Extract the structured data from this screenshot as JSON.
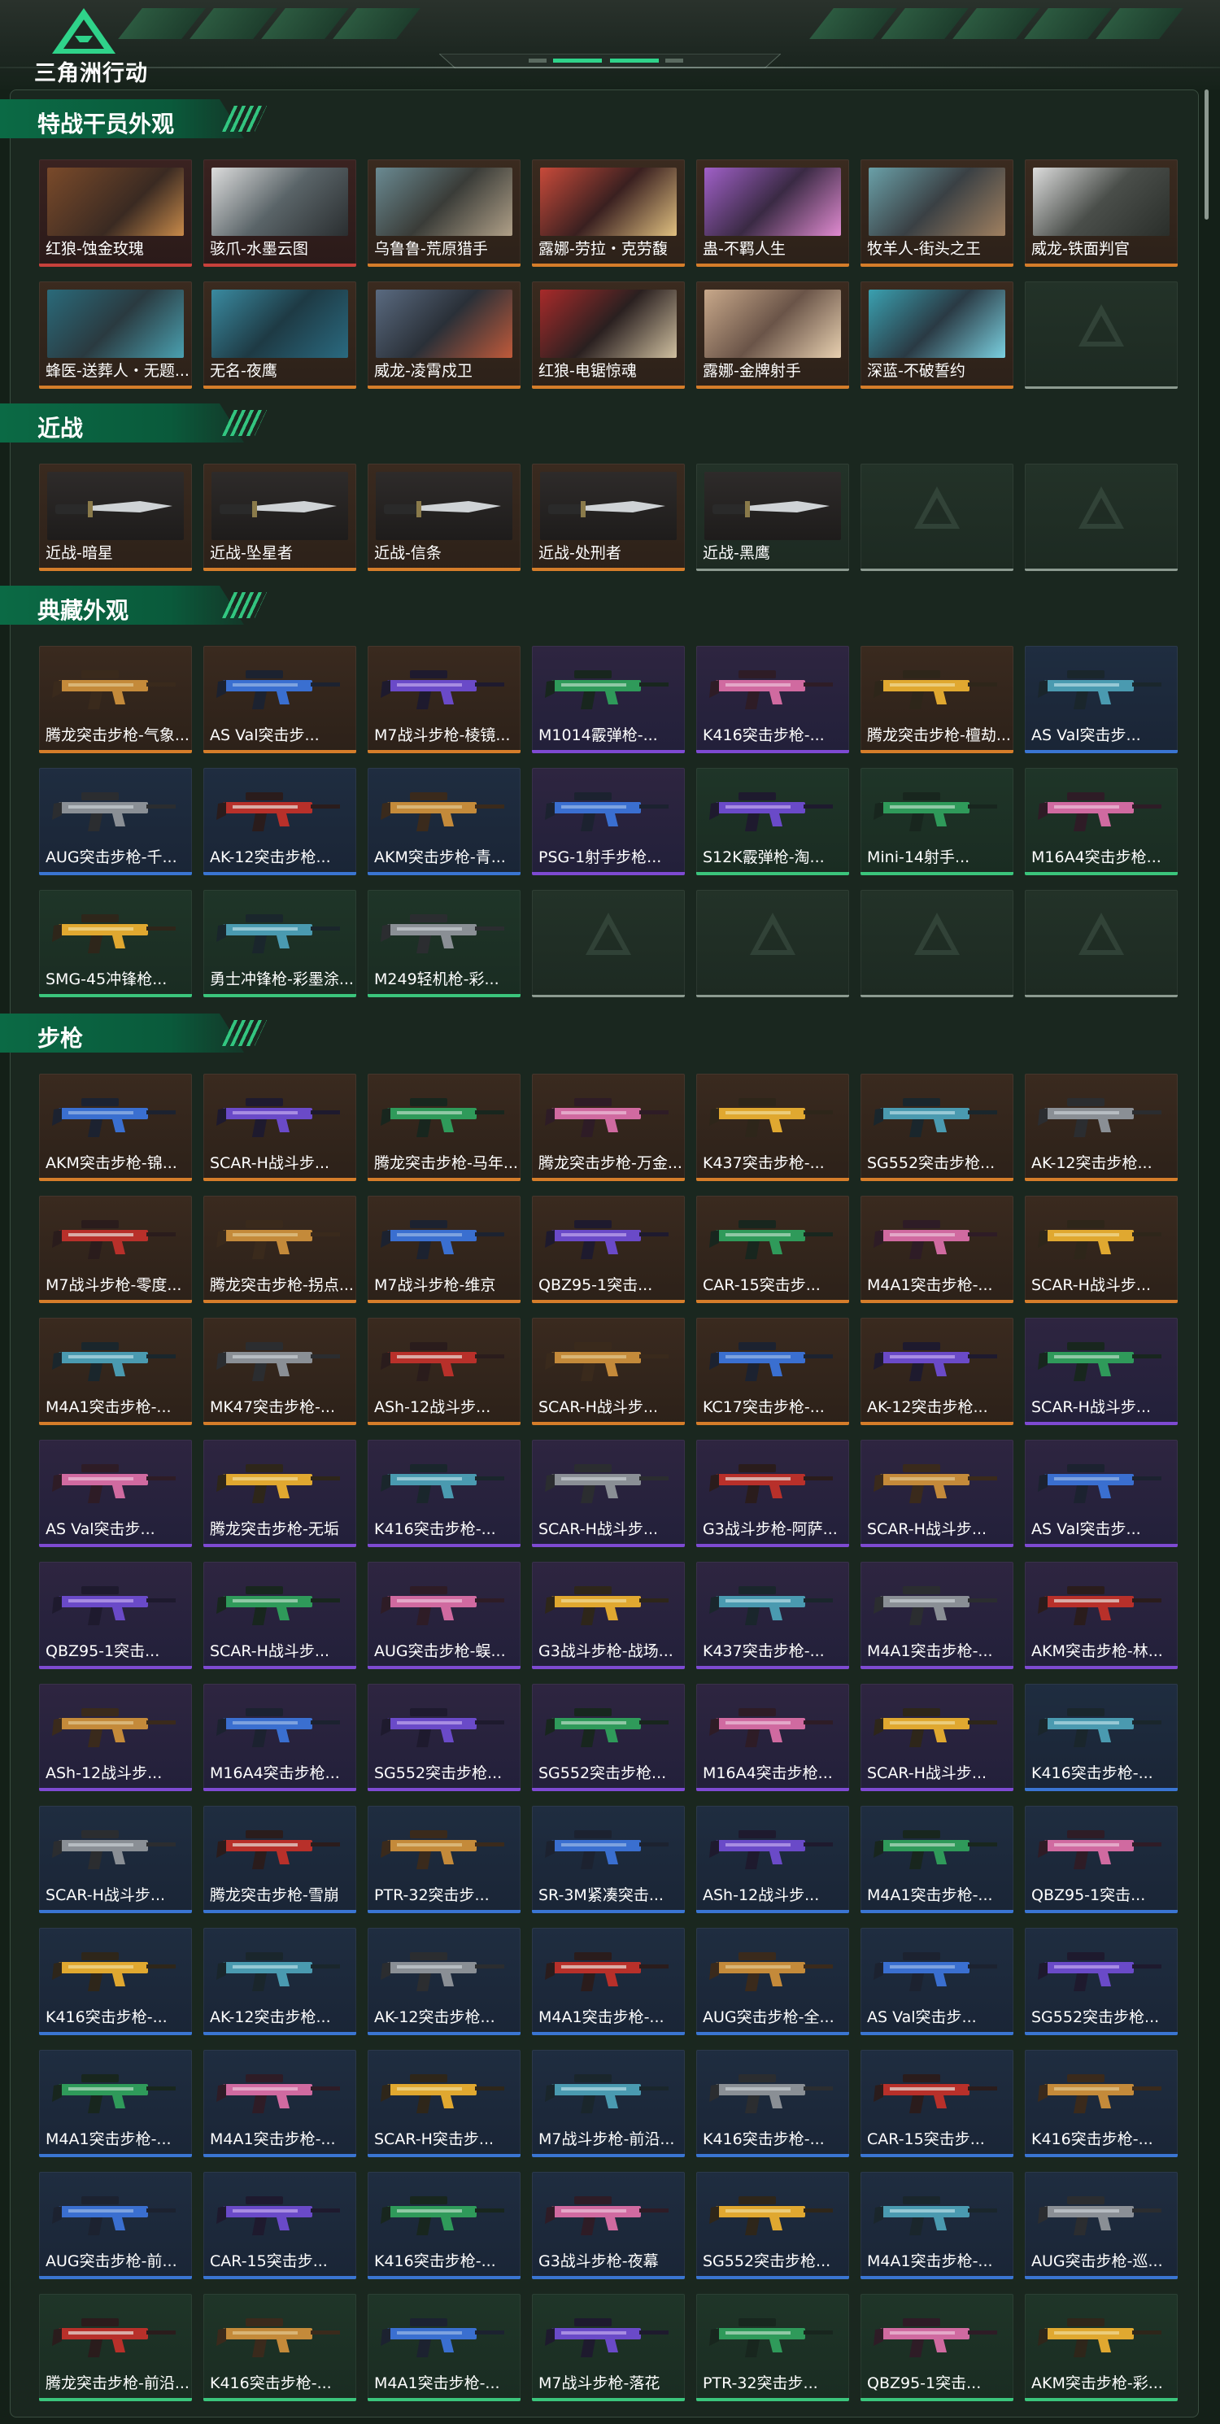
{
  "header": {
    "logo_text": "三角洲行动"
  },
  "colors": {
    "accent": "#0b6a45",
    "accent_light": "#36d68a",
    "rarity_gold": "#d57d2a",
    "rarity_red": "#c8413b",
    "rarity_purple": "#7e4ad2",
    "rarity_blue": "#3a75d2",
    "rarity_green": "#3bc57c"
  },
  "sections": [
    {
      "title": "特战干员外观",
      "items": [
        {
          "label": "红狼-蚀金玫瑰",
          "rarity": "red",
          "icon": "operator-portrait"
        },
        {
          "label": "骇爪-水墨云图",
          "rarity": "red",
          "icon": "operator-portrait"
        },
        {
          "label": "乌鲁鲁-荒原猎手",
          "rarity": "gold",
          "icon": "operator-portrait"
        },
        {
          "label": "露娜-劳拉・克劳馥",
          "rarity": "gold",
          "icon": "operator-portrait"
        },
        {
          "label": "蛊-不羁人生",
          "rarity": "gold",
          "icon": "operator-portrait"
        },
        {
          "label": "牧羊人-街头之王",
          "rarity": "gold",
          "icon": "operator-portrait"
        },
        {
          "label": "威龙-铁面判官",
          "rarity": "gold",
          "icon": "operator-portrait"
        },
        {
          "label": "蜂医-送葬人・无题...",
          "rarity": "gold",
          "icon": "operator-portrait"
        },
        {
          "label": "无名-夜鹰",
          "rarity": "gold",
          "icon": "operator-portrait"
        },
        {
          "label": "威龙-凌霄戍卫",
          "rarity": "gold",
          "icon": "operator-portrait"
        },
        {
          "label": "红狼-电锯惊魂",
          "rarity": "gold",
          "icon": "operator-portrait"
        },
        {
          "label": "露娜-金牌射手",
          "rarity": "gold",
          "icon": "operator-portrait"
        },
        {
          "label": "深蓝-不破誓约",
          "rarity": "gold",
          "icon": "operator-portrait"
        },
        {
          "label": "",
          "rarity": "empty",
          "icon": "empty-slot"
        }
      ]
    },
    {
      "title": "近战",
      "items": [
        {
          "label": "近战-暗星",
          "rarity": "gold",
          "icon": "knife"
        },
        {
          "label": "近战-坠星者",
          "rarity": "gold",
          "icon": "knife"
        },
        {
          "label": "近战-信条",
          "rarity": "gold",
          "icon": "knife"
        },
        {
          "label": "近战-处刑者",
          "rarity": "gold",
          "icon": "knife"
        },
        {
          "label": "近战-黑鹰",
          "rarity": "empty",
          "icon": "knife"
        },
        {
          "label": "",
          "rarity": "empty",
          "icon": "empty-slot"
        },
        {
          "label": "",
          "rarity": "empty",
          "icon": "empty-slot"
        }
      ]
    },
    {
      "title": "典藏外观",
      "items": [
        {
          "label": "腾龙突击步枪-气象...",
          "rarity": "gold",
          "icon": "rifle"
        },
        {
          "label": "AS Val突击步...",
          "rarity": "gold",
          "icon": "rifle"
        },
        {
          "label": "M7战斗步枪-棱镜...",
          "rarity": "gold",
          "icon": "rifle"
        },
        {
          "label": "M1014霰弹枪-...",
          "rarity": "purple",
          "icon": "rifle"
        },
        {
          "label": "K416突击步枪-...",
          "rarity": "purple",
          "icon": "rifle"
        },
        {
          "label": "腾龙突击步枪-檀劫...",
          "rarity": "gold",
          "icon": "rifle"
        },
        {
          "label": "AS Val突击步...",
          "rarity": "blue",
          "icon": "rifle"
        },
        {
          "label": "AUG突击步枪-千...",
          "rarity": "blue",
          "icon": "rifle"
        },
        {
          "label": "AK-12突击步枪...",
          "rarity": "blue",
          "icon": "rifle"
        },
        {
          "label": "AKM突击步枪-青...",
          "rarity": "blue",
          "icon": "rifle"
        },
        {
          "label": "PSG-1射手步枪...",
          "rarity": "purple",
          "icon": "rifle"
        },
        {
          "label": "S12K霰弹枪-淘...",
          "rarity": "green",
          "icon": "rifle"
        },
        {
          "label": "Mini-14射手...",
          "rarity": "green",
          "icon": "rifle"
        },
        {
          "label": "M16A4突击步枪...",
          "rarity": "green",
          "icon": "rifle"
        },
        {
          "label": "SMG-45冲锋枪...",
          "rarity": "green",
          "icon": "rifle"
        },
        {
          "label": "勇士冲锋枪-彩墨涂...",
          "rarity": "green",
          "icon": "rifle"
        },
        {
          "label": "M249轻机枪-彩...",
          "rarity": "green",
          "icon": "rifle"
        },
        {
          "label": "",
          "rarity": "empty",
          "icon": "empty-slot"
        },
        {
          "label": "",
          "rarity": "empty",
          "icon": "empty-slot"
        },
        {
          "label": "",
          "rarity": "empty",
          "icon": "empty-slot"
        },
        {
          "label": "",
          "rarity": "empty",
          "icon": "empty-slot"
        }
      ]
    },
    {
      "title": "步枪",
      "items": [
        {
          "label": "AKM突击步枪-锦...",
          "rarity": "gold",
          "icon": "rifle"
        },
        {
          "label": "SCAR-H战斗步...",
          "rarity": "gold",
          "icon": "rifle"
        },
        {
          "label": "腾龙突击步枪-马年...",
          "rarity": "gold",
          "icon": "rifle"
        },
        {
          "label": "腾龙突击步枪-万金...",
          "rarity": "gold",
          "icon": "rifle"
        },
        {
          "label": "K437突击步枪-...",
          "rarity": "gold",
          "icon": "rifle"
        },
        {
          "label": "SG552突击步枪...",
          "rarity": "gold",
          "icon": "rifle"
        },
        {
          "label": "AK-12突击步枪...",
          "rarity": "gold",
          "icon": "rifle"
        },
        {
          "label": "M7战斗步枪-零度...",
          "rarity": "gold",
          "icon": "rifle"
        },
        {
          "label": "腾龙突击步枪-拐点...",
          "rarity": "gold",
          "icon": "rifle"
        },
        {
          "label": "M7战斗步枪-维京",
          "rarity": "gold",
          "icon": "rifle"
        },
        {
          "label": "QBZ95-1突击...",
          "rarity": "gold",
          "icon": "rifle"
        },
        {
          "label": "CAR-15突击步...",
          "rarity": "gold",
          "icon": "rifle"
        },
        {
          "label": "M4A1突击步枪-...",
          "rarity": "gold",
          "icon": "rifle"
        },
        {
          "label": "SCAR-H战斗步...",
          "rarity": "gold",
          "icon": "rifle"
        },
        {
          "label": "M4A1突击步枪-...",
          "rarity": "gold",
          "icon": "rifle"
        },
        {
          "label": "MK47突击步枪-...",
          "rarity": "gold",
          "icon": "rifle"
        },
        {
          "label": "ASh-12战斗步...",
          "rarity": "gold",
          "icon": "rifle"
        },
        {
          "label": "SCAR-H战斗步...",
          "rarity": "gold",
          "icon": "rifle"
        },
        {
          "label": "KC17突击步枪-...",
          "rarity": "gold",
          "icon": "rifle"
        },
        {
          "label": "AK-12突击步枪...",
          "rarity": "gold",
          "icon": "rifle"
        },
        {
          "label": "SCAR-H战斗步...",
          "rarity": "purple",
          "icon": "rifle"
        },
        {
          "label": "AS Val突击步...",
          "rarity": "purple",
          "icon": "rifle"
        },
        {
          "label": "腾龙突击步枪-无垢",
          "rarity": "purple",
          "icon": "rifle"
        },
        {
          "label": "K416突击步枪-...",
          "rarity": "purple",
          "icon": "rifle"
        },
        {
          "label": "SCAR-H战斗步...",
          "rarity": "purple",
          "icon": "rifle"
        },
        {
          "label": "G3战斗步枪-阿萨...",
          "rarity": "purple",
          "icon": "rifle"
        },
        {
          "label": "SCAR-H战斗步...",
          "rarity": "purple",
          "icon": "rifle"
        },
        {
          "label": "AS Val突击步...",
          "rarity": "purple",
          "icon": "rifle"
        },
        {
          "label": "QBZ95-1突击...",
          "rarity": "purple",
          "icon": "rifle"
        },
        {
          "label": "SCAR-H战斗步...",
          "rarity": "purple",
          "icon": "rifle"
        },
        {
          "label": "AUG突击步枪-蜈...",
          "rarity": "purple",
          "icon": "rifle"
        },
        {
          "label": "G3战斗步枪-战场...",
          "rarity": "purple",
          "icon": "rifle"
        },
        {
          "label": "K437突击步枪-...",
          "rarity": "purple",
          "icon": "rifle"
        },
        {
          "label": "M4A1突击步枪-...",
          "rarity": "purple",
          "icon": "rifle"
        },
        {
          "label": "AKM突击步枪-林...",
          "rarity": "purple",
          "icon": "rifle"
        },
        {
          "label": "ASh-12战斗步...",
          "rarity": "purple",
          "icon": "rifle"
        },
        {
          "label": "M16A4突击步枪...",
          "rarity": "purple",
          "icon": "rifle"
        },
        {
          "label": "SG552突击步枪...",
          "rarity": "purple",
          "icon": "rifle"
        },
        {
          "label": "SG552突击步枪...",
          "rarity": "purple",
          "icon": "rifle"
        },
        {
          "label": "M16A4突击步枪...",
          "rarity": "purple",
          "icon": "rifle"
        },
        {
          "label": "SCAR-H战斗步...",
          "rarity": "purple",
          "icon": "rifle"
        },
        {
          "label": "K416突击步枪-...",
          "rarity": "blue",
          "icon": "rifle"
        },
        {
          "label": "SCAR-H战斗步...",
          "rarity": "blue",
          "icon": "rifle"
        },
        {
          "label": "腾龙突击步枪-雪崩",
          "rarity": "blue",
          "icon": "rifle"
        },
        {
          "label": "PTR-32突击步...",
          "rarity": "blue",
          "icon": "rifle"
        },
        {
          "label": "SR-3M紧凑突击...",
          "rarity": "blue",
          "icon": "rifle"
        },
        {
          "label": "ASh-12战斗步...",
          "rarity": "blue",
          "icon": "rifle"
        },
        {
          "label": "M4A1突击步枪-...",
          "rarity": "blue",
          "icon": "rifle"
        },
        {
          "label": "QBZ95-1突击...",
          "rarity": "blue",
          "icon": "rifle"
        },
        {
          "label": "K416突击步枪-...",
          "rarity": "blue",
          "icon": "rifle"
        },
        {
          "label": "AK-12突击步枪...",
          "rarity": "blue",
          "icon": "rifle"
        },
        {
          "label": "AK-12突击步枪...",
          "rarity": "blue",
          "icon": "rifle"
        },
        {
          "label": "M4A1突击步枪-...",
          "rarity": "blue",
          "icon": "rifle"
        },
        {
          "label": "AUG突击步枪-全...",
          "rarity": "blue",
          "icon": "rifle"
        },
        {
          "label": "AS Val突击步...",
          "rarity": "blue",
          "icon": "rifle"
        },
        {
          "label": "SG552突击步枪...",
          "rarity": "blue",
          "icon": "rifle"
        },
        {
          "label": "M4A1突击步枪-...",
          "rarity": "blue",
          "icon": "rifle"
        },
        {
          "label": "M4A1突击步枪-...",
          "rarity": "blue",
          "icon": "rifle"
        },
        {
          "label": "SCAR-H突击步...",
          "rarity": "blue",
          "icon": "rifle"
        },
        {
          "label": "M7战斗步枪-前沿...",
          "rarity": "blue",
          "icon": "rifle"
        },
        {
          "label": "K416突击步枪-...",
          "rarity": "blue",
          "icon": "rifle"
        },
        {
          "label": "CAR-15突击步...",
          "rarity": "blue",
          "icon": "rifle"
        },
        {
          "label": "K416突击步枪-...",
          "rarity": "blue",
          "icon": "rifle"
        },
        {
          "label": "AUG突击步枪-前...",
          "rarity": "blue",
          "icon": "rifle"
        },
        {
          "label": "CAR-15突击步...",
          "rarity": "blue",
          "icon": "rifle"
        },
        {
          "label": "K416突击步枪-...",
          "rarity": "blue",
          "icon": "rifle"
        },
        {
          "label": "G3战斗步枪-夜幕",
          "rarity": "blue",
          "icon": "rifle"
        },
        {
          "label": "SG552突击步枪...",
          "rarity": "blue",
          "icon": "rifle"
        },
        {
          "label": "M4A1突击步枪-...",
          "rarity": "blue",
          "icon": "rifle"
        },
        {
          "label": "AUG突击步枪-巡...",
          "rarity": "blue",
          "icon": "rifle"
        },
        {
          "label": "腾龙突击步枪-前沿...",
          "rarity": "green",
          "icon": "rifle"
        },
        {
          "label": "K416突击步枪-...",
          "rarity": "green",
          "icon": "rifle"
        },
        {
          "label": "M4A1突击步枪-...",
          "rarity": "green",
          "icon": "rifle"
        },
        {
          "label": "M7战斗步枪-落花",
          "rarity": "green",
          "icon": "rifle"
        },
        {
          "label": "PTR-32突击步...",
          "rarity": "green",
          "icon": "rifle"
        },
        {
          "label": "QBZ95-1突击...",
          "rarity": "green",
          "icon": "rifle"
        },
        {
          "label": "AKM突击步枪-彩...",
          "rarity": "green",
          "icon": "rifle"
        }
      ]
    }
  ]
}
